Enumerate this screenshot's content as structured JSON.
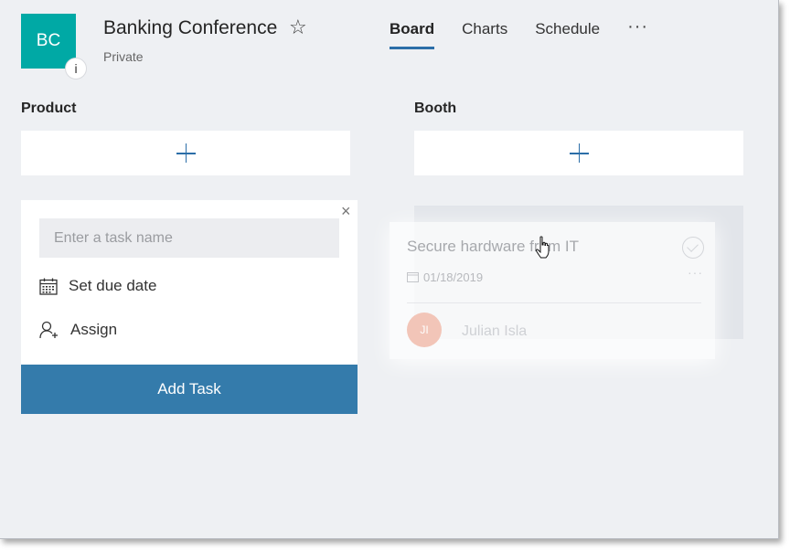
{
  "header": {
    "avatar_initials": "BC",
    "info_glyph": "i",
    "plan_title": "Banking Conference",
    "plan_subtitle": "Private",
    "star_glyph": "☆",
    "more_glyph": "···"
  },
  "tabs": [
    {
      "label": "Board",
      "active": true
    },
    {
      "label": "Charts",
      "active": false
    },
    {
      "label": "Schedule",
      "active": false
    }
  ],
  "buckets": [
    {
      "name": "Product"
    },
    {
      "name": "Booth"
    }
  ],
  "task_form": {
    "input_placeholder": "Enter a task name",
    "input_value": "",
    "due_date_label": "Set due date",
    "assign_label": "Assign",
    "add_button_label": "Add Task",
    "close_glyph": "×"
  },
  "dragged_card": {
    "title": "Secure hardware from IT",
    "due_date": "01/18/2019",
    "more_glyph": "···",
    "assignee_initials": "JI",
    "assignee_name": "Julian Isla"
  },
  "icons": {
    "calendar": "calendar-icon",
    "assign": "person-add-icon",
    "add": "plus-icon",
    "close": "close-icon",
    "favorite": "star-icon"
  },
  "colors": {
    "accent": "#2b6ea8",
    "add_button": "#347bab",
    "avatar": "#00a9a5",
    "board_background": "#eef0f3"
  }
}
